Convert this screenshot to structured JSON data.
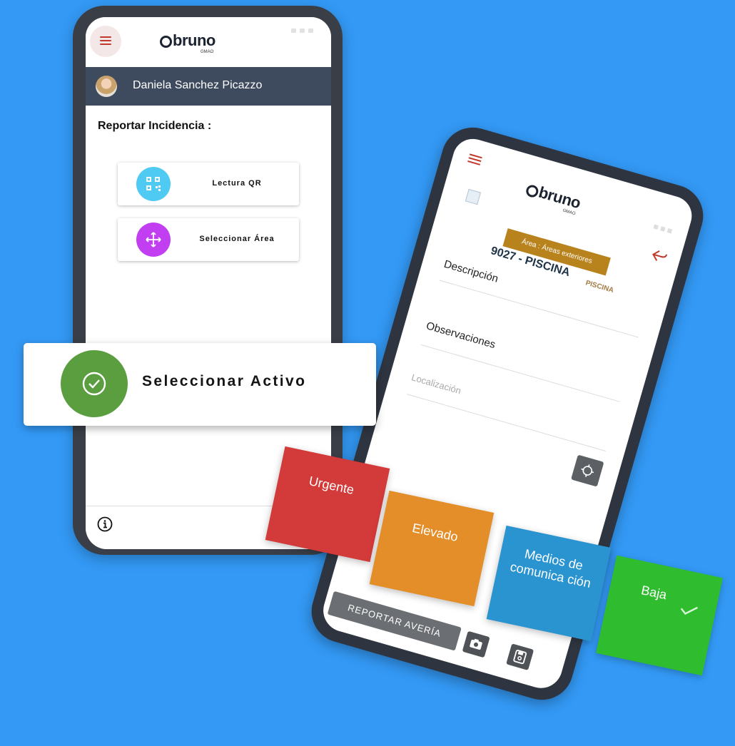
{
  "phone1": {
    "logo": {
      "word": "bruno",
      "sub": "GMAO"
    },
    "user_name": "Daniela Sanchez Picazzo",
    "page_title": "Reportar Incidencia :",
    "options": [
      {
        "label": "Lectura QR",
        "icon": "qr-code-icon",
        "color": "#4fcaf3"
      },
      {
        "label": "Seleccionar Área",
        "icon": "move-arrows-icon",
        "color": "#c23ff1"
      }
    ],
    "info_icon": "info-icon"
  },
  "activo_card": {
    "label": "Seleccionar Activo",
    "icon": "check-circle-icon",
    "color": "#5a9e3f"
  },
  "phone2": {
    "logo": {
      "word": "bruno",
      "sub": "GMAO"
    },
    "area_badge": "Área : Áreas exteriores",
    "asset_code": "9027 - PISCINA",
    "asset_tag": "PISCINA",
    "fields": {
      "descripcion": "Descripción",
      "observaciones": "Observaciones",
      "localizacion_placeholder": "Localización"
    },
    "report_button": "REPORTAR AVERÍA"
  },
  "priorities": [
    {
      "label": "Urgente",
      "color": "#d33a3a"
    },
    {
      "label": "Elevado",
      "color": "#e48e2a"
    },
    {
      "label": "Medios de comunica ción",
      "color": "#2a94d1"
    },
    {
      "label": "Baja",
      "color": "#2fbd2f",
      "selected": true
    }
  ],
  "colors": {
    "background": "#3399f5",
    "user_bar": "#3e4a5e",
    "badge": "#b8821c"
  }
}
